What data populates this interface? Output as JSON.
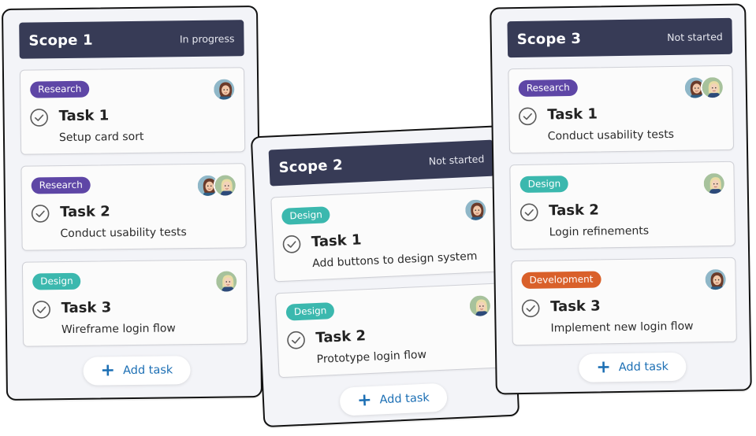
{
  "boards": [
    {
      "title": "Scope 1",
      "status": "In progress",
      "add_label": "Add task",
      "cards": [
        {
          "tag": "Research",
          "title": "Task 1",
          "desc": "Setup card sort"
        },
        {
          "tag": "Research",
          "title": "Task 2",
          "desc": "Conduct usability tests"
        },
        {
          "tag": "Design",
          "title": "Task 3",
          "desc": "Wireframe login flow"
        }
      ]
    },
    {
      "title": "Scope 2",
      "status": "Not started",
      "add_label": "Add task",
      "cards": [
        {
          "tag": "Design",
          "title": "Task 1",
          "desc": "Add buttons to design system"
        },
        {
          "tag": "Design",
          "title": "Task 2",
          "desc": "Prototype login flow"
        }
      ]
    },
    {
      "title": "Scope 3",
      "status": "Not started",
      "add_label": "Add task",
      "cards": [
        {
          "tag": "Research",
          "title": "Task 1",
          "desc": "Conduct usability tests"
        },
        {
          "tag": "Design",
          "title": "Task 2",
          "desc": "Login refinements"
        },
        {
          "tag": "Development",
          "title": "Task 3",
          "desc": "Implement new login flow"
        }
      ]
    }
  ],
  "colors": {
    "header": "#373b56",
    "research": "#5e46a6",
    "design": "#3bb8ae",
    "development": "#d9602a",
    "link": "#1c6fb4"
  },
  "icons": {
    "complete": "check-circle-icon",
    "add": "plus-icon",
    "user": "avatar"
  }
}
